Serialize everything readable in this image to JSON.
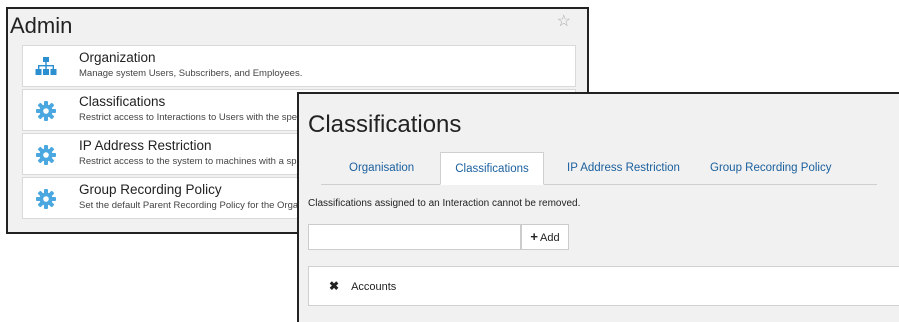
{
  "admin": {
    "title": "Admin",
    "star": "☆",
    "items": [
      {
        "name": "Organization",
        "desc": "Manage system Users, Subscribers, and Employees."
      },
      {
        "name": "Classifications",
        "desc": "Restrict access to Interactions to Users with the spe"
      },
      {
        "name": "IP Address Restriction",
        "desc": "Restrict access to the system to machines with a sp"
      },
      {
        "name": "Group Recording Policy",
        "desc": "Set the default Parent Recording Policy for the Orga"
      }
    ]
  },
  "classifications": {
    "title": "Classifications",
    "tabs": [
      {
        "label": "Organisation"
      },
      {
        "label": "Classifications"
      },
      {
        "label": "IP Address Restriction"
      },
      {
        "label": "Group Recording Policy"
      }
    ],
    "note": "Classifications assigned to an Interaction cannot be removed.",
    "input_value": "",
    "add_icon": "+",
    "add_label": "Add",
    "remove_icon": "✖",
    "list": [
      {
        "label": "Accounts"
      }
    ]
  },
  "colors": {
    "link": "#1a5f9e",
    "org_icon": "#2b8fd0",
    "gear_icon": "#4aa7e0"
  }
}
